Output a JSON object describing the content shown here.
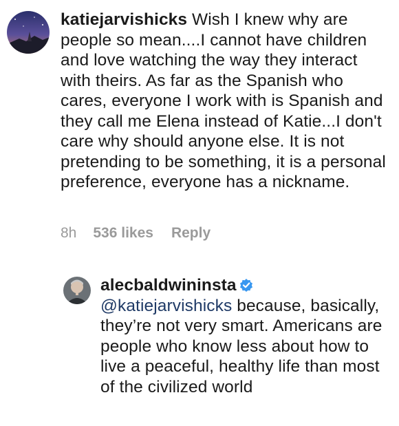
{
  "comments": [
    {
      "username": "katiejarvishicks",
      "text": " Wish I knew why are people so mean....I cannot have children and love watching the way they interact with theirs. As far as the Spanish who cares, everyone I work with is Spanish and they call me Elena instead of Katie...I don't care why should anyone else. It is not pretending to be something, it is a personal preference, everyone has a nickname.",
      "time": "8h",
      "likes": "536 likes",
      "reply_label": "Reply",
      "avatar_icon": "night-sky-avatar"
    }
  ],
  "reply": {
    "username": "alecbaldwininsta",
    "verified_icon": "verified-badge-icon",
    "mention": "@katiejarvishicks",
    "text": " because, basically, they’re not very smart. Americans are people who know less about how to live a peaceful, healthy life than most of the civilized world",
    "avatar_icon": "profile-photo-avatar"
  },
  "colors": {
    "mention": "#1f3a66",
    "meta": "#9a9a9a",
    "verified": "#3897f0"
  }
}
